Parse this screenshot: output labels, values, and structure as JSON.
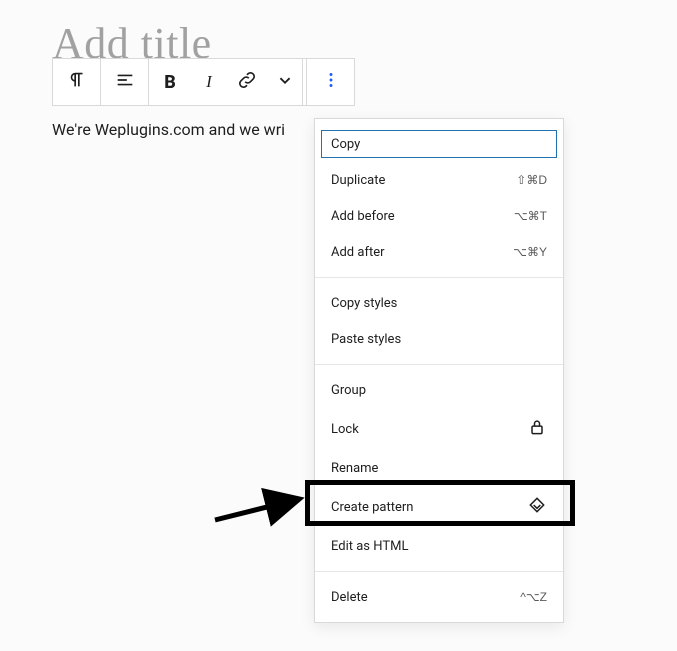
{
  "title_placeholder": "Add title",
  "paragraph_text": "We're Weplugins.com and we wri",
  "menu": {
    "copy": "Copy",
    "duplicate": "Duplicate",
    "duplicate_shortcut": "⇧⌘D",
    "add_before": "Add before",
    "add_before_shortcut": "⌥⌘T",
    "add_after": "Add after",
    "add_after_shortcut": "⌥⌘Y",
    "copy_styles": "Copy styles",
    "paste_styles": "Paste styles",
    "group": "Group",
    "lock": "Lock",
    "rename": "Rename",
    "create_pattern": "Create pattern",
    "edit_html": "Edit as HTML",
    "delete": "Delete",
    "delete_shortcut": "^⌥Z"
  }
}
